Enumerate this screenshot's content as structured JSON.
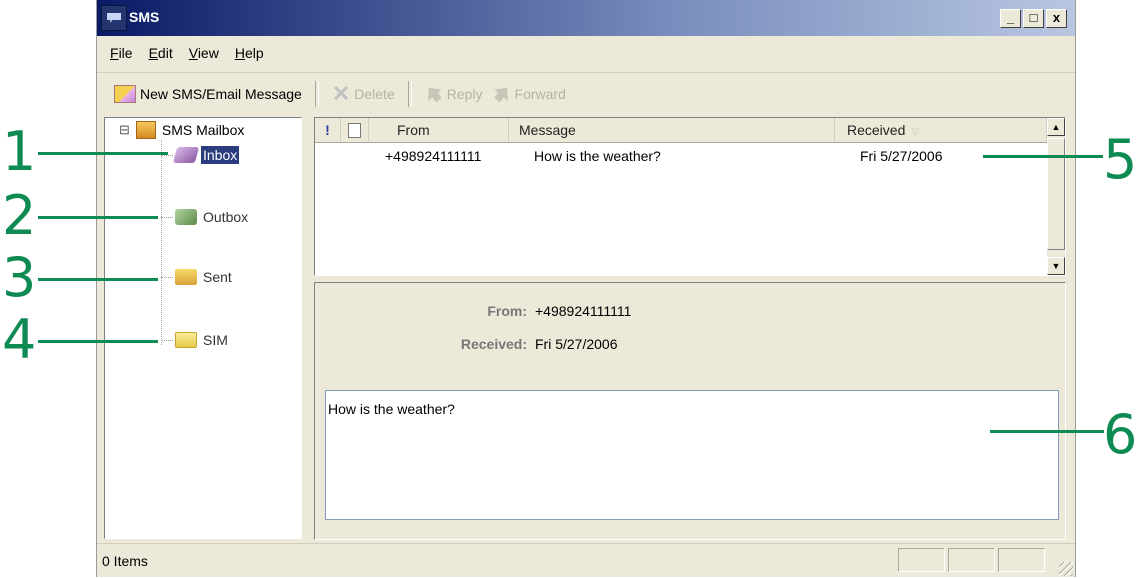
{
  "window": {
    "title": "SMS",
    "controls": {
      "minimize": "_",
      "maximize": "□",
      "close": "x"
    }
  },
  "menu": [
    "File",
    "Edit",
    "View",
    "Help"
  ],
  "toolbar": {
    "new": "New SMS/Email Message",
    "delete": "Delete",
    "reply": "Reply",
    "forward": "Forward"
  },
  "tree": {
    "root": "SMS Mailbox",
    "expand_symbol": "⊟",
    "folders": [
      "Inbox",
      "Outbox",
      "Sent",
      "SIM"
    ],
    "selected": "Inbox"
  },
  "list": {
    "columns": [
      "From",
      "Message",
      "Received"
    ],
    "rows": [
      {
        "from": "+498924111111",
        "message": "How is the weather?",
        "received": "Fri 5/27/2006"
      }
    ]
  },
  "preview": {
    "from_label": "From:",
    "from_value": "+498924111111",
    "received_label": "Received:",
    "received_value": "Fri 5/27/2006",
    "body": "How is the weather?"
  },
  "statusbar": {
    "text": "0 Items"
  },
  "callouts": [
    "1",
    "2",
    "3",
    "4",
    "5",
    "6"
  ],
  "colors": {
    "callout": "#0e8a53",
    "titlebar": "#0a1a66",
    "selection": "#2b3d7e"
  }
}
